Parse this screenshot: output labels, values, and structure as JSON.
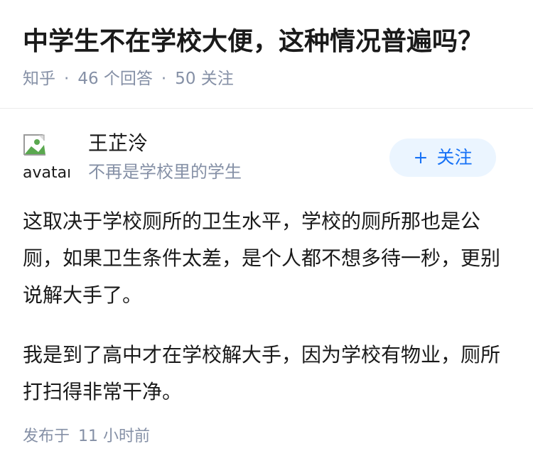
{
  "question": {
    "title": "中学生不在学校大便，这种情况普遍吗？",
    "source": "知乎",
    "answer_count": "46 个回答",
    "follower_count": "50 关注"
  },
  "author": {
    "avatar_alt": "avatar",
    "name": "王芷泠",
    "bio": "不再是学校里的学生",
    "follow_plus": "+",
    "follow_label": "关注"
  },
  "answer": {
    "paragraphs": [
      "这取决于学校厕所的卫生水平，学校的厕所那也是公厕，如果卫生条件太差，是个人都不想多待一秒，更别说解大手了。",
      "我是到了高中才在学校解大手，因为学校有物业，厕所打扫得非常干净。"
    ],
    "published_prefix": "发布于",
    "published_time": "11 小时前"
  },
  "colors": {
    "accent": "#1772f6",
    "follow_bg": "#ebf5ff",
    "meta": "#8590a6",
    "text": "#1a1a1a"
  }
}
